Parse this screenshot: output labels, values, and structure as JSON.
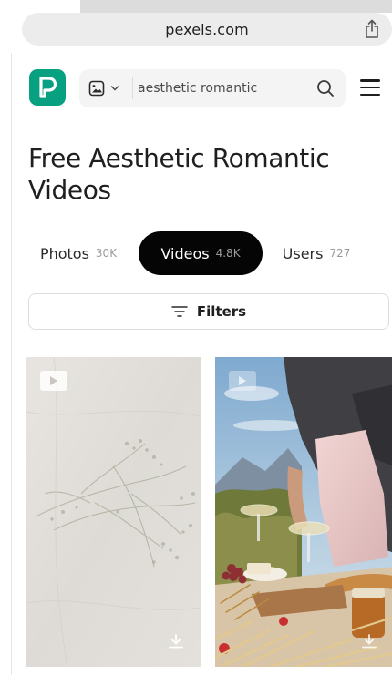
{
  "browser": {
    "url": "pexels.com"
  },
  "header": {
    "logo_letter": "P",
    "brand_color": "#07a081",
    "search": {
      "type_icon": "image-icon",
      "value": "aesthetic romantic",
      "search_icon": "search-icon"
    },
    "menu_icon": "hamburger-menu-icon"
  },
  "page": {
    "title": "Free Aesthetic Romantic Videos"
  },
  "tabs": [
    {
      "label": "Photos",
      "count": "30K",
      "active": false
    },
    {
      "label": "Videos",
      "count": "4.8K",
      "active": true
    },
    {
      "label": "Users",
      "count": "727",
      "active": false
    }
  ],
  "filters": {
    "label": "Filters",
    "icon": "filter-lines-icon"
  },
  "results": [
    {
      "kind": "video",
      "subject": "shadow of dried flowers on linen",
      "icons": [
        "play-icon",
        "download-icon"
      ]
    },
    {
      "kind": "video",
      "subject": "outdoor picnic with wine glasses",
      "icons": [
        "play-icon",
        "download-icon"
      ]
    }
  ]
}
